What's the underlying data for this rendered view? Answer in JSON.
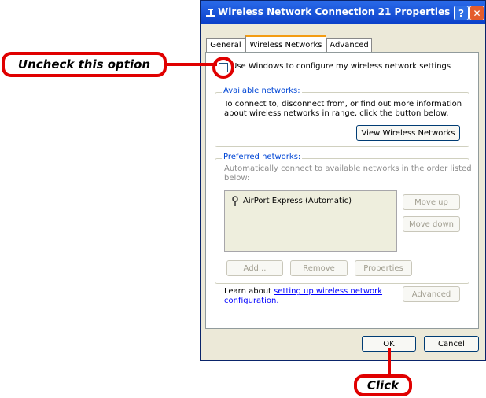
{
  "window": {
    "title": "Wireless Network Connection 21 Properties",
    "help_glyph": "?",
    "close_glyph": "✕"
  },
  "tabs": [
    {
      "label": "General"
    },
    {
      "label": "Wireless Networks"
    },
    {
      "label": "Advanced"
    }
  ],
  "checkbox": {
    "label": "Use Windows to configure my wireless network settings",
    "checked": false
  },
  "available": {
    "legend": "Available networks:",
    "text_line1": "To connect to, disconnect from, or find out more information",
    "text_line2": "about wireless networks in range, click the button below.",
    "button": "View Wireless Networks"
  },
  "preferred": {
    "legend": "Preferred networks:",
    "text_line1": "Automatically connect to available networks in the order listed",
    "text_line2": "below:",
    "items": [
      {
        "label": "AirPort Express (Automatic)"
      }
    ],
    "move_up": "Move up",
    "move_down": "Move down",
    "add": "Add...",
    "remove": "Remove",
    "properties": "Properties"
  },
  "learn": {
    "prefix": "Learn about ",
    "link1": "setting up wireless network",
    "link2": "configuration.",
    "button": "Advanced"
  },
  "footer": {
    "ok": "OK",
    "cancel": "Cancel"
  },
  "annotations": {
    "uncheck": "Uncheck this option",
    "click": "Click"
  },
  "colors": {
    "accent": "#e00000",
    "titlebar": "#0a3fc8"
  }
}
